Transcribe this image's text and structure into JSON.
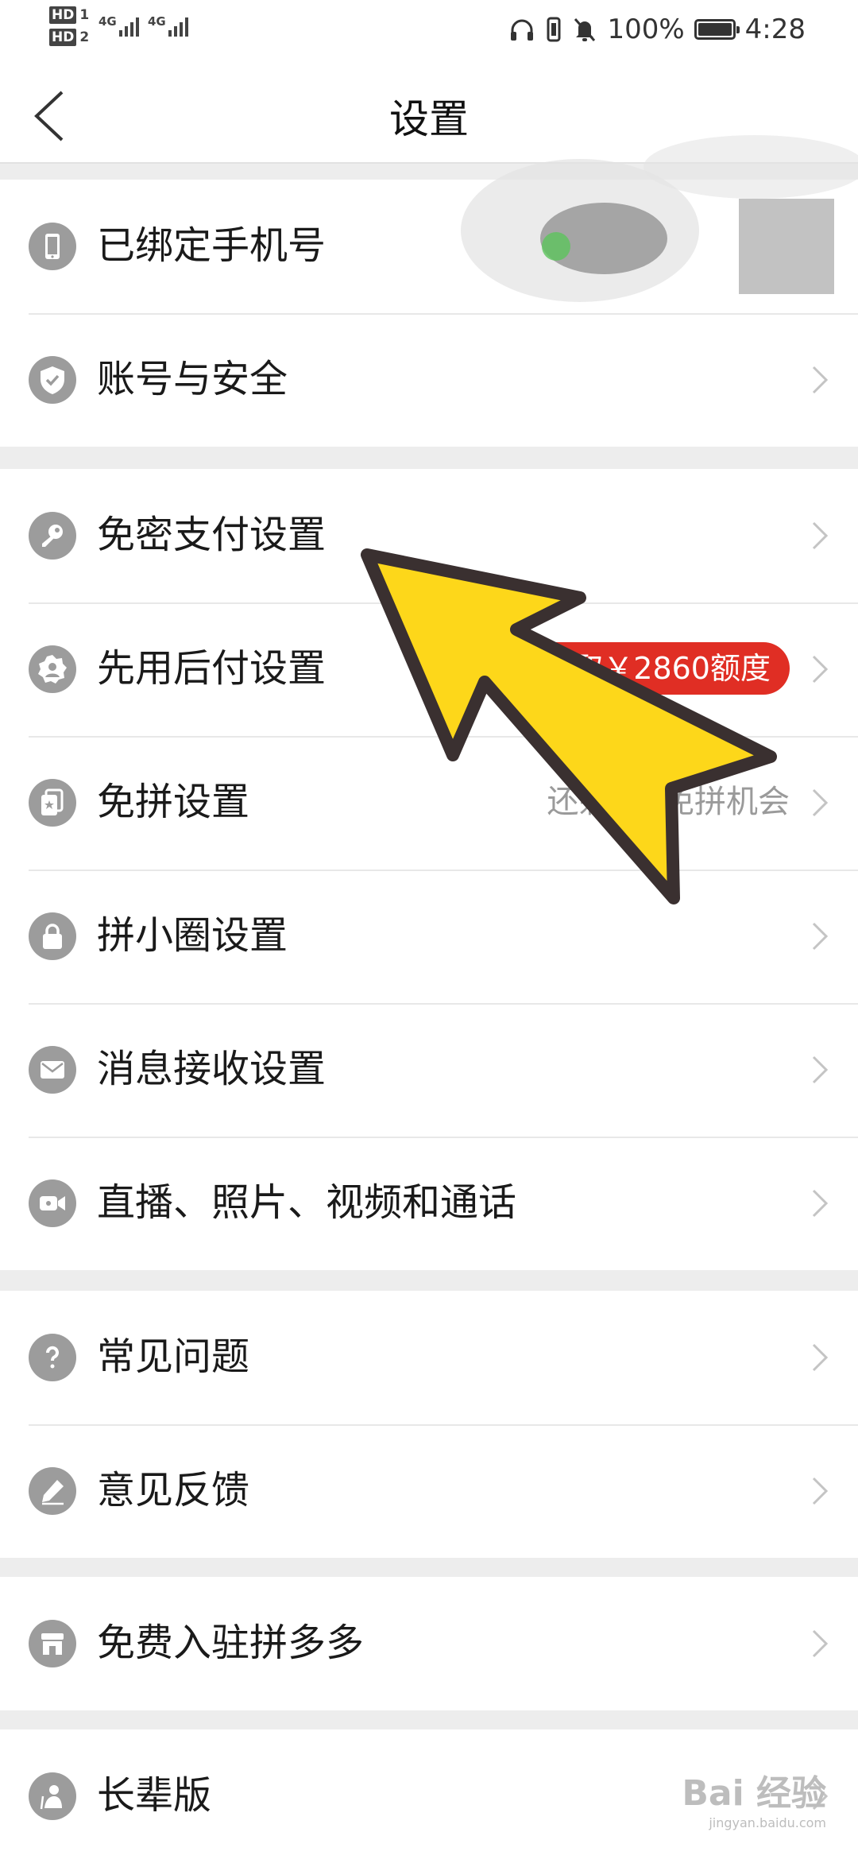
{
  "status_bar": {
    "sim1_label": "HD",
    "sim1_num": "1",
    "sim2_label": "HD",
    "sim2_num": "2",
    "network1": "4G",
    "network2": "4G",
    "battery_percent": "100%",
    "time": "4:28"
  },
  "header": {
    "title": "设置",
    "back_icon": "chevron-left-icon"
  },
  "groups": [
    {
      "items": [
        {
          "label": "已绑定手机号",
          "icon": "phone-icon"
        },
        {
          "label": "账号与安全",
          "icon": "shield-check-icon"
        }
      ]
    },
    {
      "items": [
        {
          "label": "免密支付设置",
          "icon": "key-icon"
        },
        {
          "label": "先用后付设置",
          "icon": "badge-user-icon",
          "badge": "领取￥2860额度",
          "badge_color": "#e02e24"
        },
        {
          "label": "免拼设置",
          "icon": "card-star-icon",
          "value": "还剩1次免拼机会"
        },
        {
          "label": "拼小圈设置",
          "icon": "lock-icon"
        },
        {
          "label": "消息接收设置",
          "icon": "envelope-icon"
        },
        {
          "label": "直播、照片、视频和通话",
          "icon": "video-camera-icon"
        }
      ]
    },
    {
      "items": [
        {
          "label": "常见问题",
          "icon": "question-icon"
        },
        {
          "label": "意见反馈",
          "icon": "pencil-icon"
        }
      ]
    },
    {
      "items": [
        {
          "label": "免费入驻拼多多",
          "icon": "store-icon"
        }
      ]
    },
    {
      "items": [
        {
          "label": "长辈版",
          "icon": "elder-icon"
        }
      ]
    }
  ],
  "annotation": {
    "color": "#fdd71a",
    "outline": "#3a3030",
    "icon": "pointer-arrow-icon"
  },
  "watermark": {
    "text": "Bai 经验",
    "url": "jingyan.baidu.com"
  }
}
